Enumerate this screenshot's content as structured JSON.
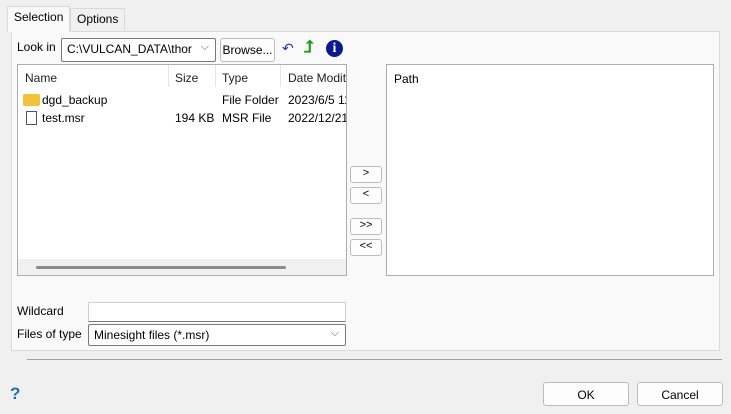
{
  "tabs": [
    {
      "label": "Selection"
    },
    {
      "label": "Options"
    }
  ],
  "look_in": {
    "label": "Look in",
    "value": "C:\\VULCAN_DATA\\thor",
    "browse": "Browse..."
  },
  "file_list": {
    "columns": [
      "Name",
      "Size",
      "Type",
      "Date Modit"
    ],
    "rows": [
      {
        "name": "dgd_backup",
        "size": "",
        "type": "File Folder",
        "date": "2023/6/5 11",
        "icon": "folder-icon"
      },
      {
        "name": "test.msr",
        "size": "194 KB",
        "type": "MSR File",
        "date": "2022/12/21",
        "icon": "file-icon"
      }
    ]
  },
  "transfer": {
    "add": ">",
    "remove": "<",
    "add_all": ">>",
    "remove_all": "<<"
  },
  "path_list": {
    "header": "Path"
  },
  "wildcard": {
    "label": "Wildcard",
    "value": ""
  },
  "files_of_type": {
    "label": "Files of type",
    "value": "Minesight files (*.msr)"
  },
  "footer": {
    "help": "?",
    "ok": "OK",
    "cancel": "Cancel"
  },
  "colors": {
    "help": "#1a6fb5",
    "up_arrow": "#1aa01a",
    "info": "#0a1a8c"
  }
}
